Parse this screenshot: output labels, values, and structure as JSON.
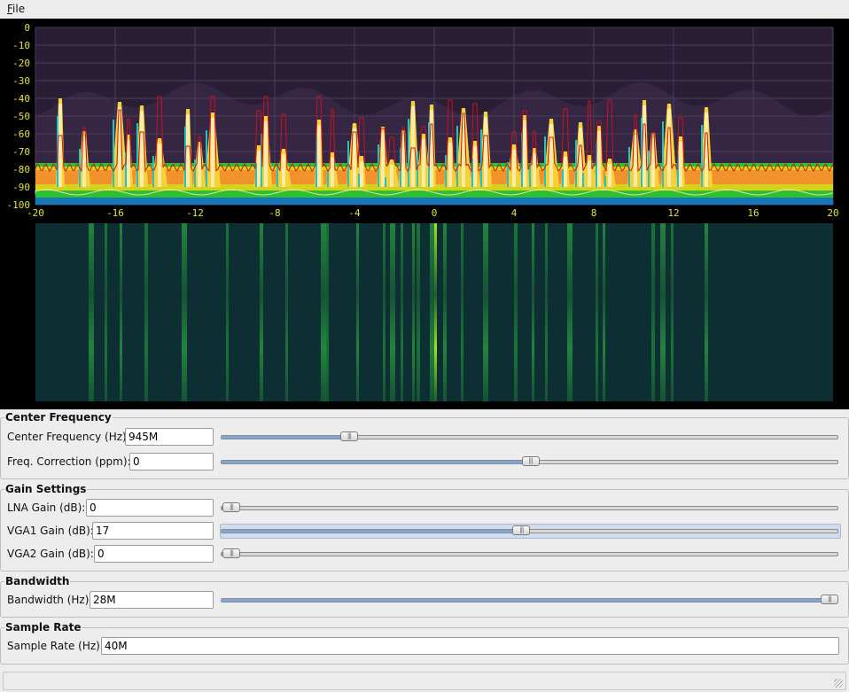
{
  "menubar": {
    "file": "File"
  },
  "spectrum": {
    "y_ticks": [
      "0",
      "-10",
      "-20",
      "-30",
      "-40",
      "-50",
      "-60",
      "-70",
      "-80",
      "-90",
      "-100"
    ],
    "x_ticks": [
      "-20",
      "-16",
      "-12",
      "-8",
      "-4",
      "0",
      "4",
      "8",
      "12",
      "16",
      "20"
    ],
    "colors": {
      "background": "#000000",
      "plot_bg": "#2a1d36",
      "axis_text": "#e6e23c",
      "peak_hold": "#d01020"
    }
  },
  "center_frequency": {
    "title": "Center Frequency",
    "freq_label": "Center Frequency (Hz):",
    "freq_value": "945M",
    "freq_slider_level": 0.197,
    "corr_label": "Freq. Correction (ppm):",
    "corr_value": "0",
    "corr_slider_level": 0.5
  },
  "gain": {
    "title": "Gain Settings",
    "lna_label": "LNA Gain (dB):",
    "lna_value": "0",
    "lna_slider_level": 0.0,
    "vga1_label": "VGA1 Gain (dB):",
    "vga1_value": "17",
    "vga1_slider_level": 0.485,
    "vga2_label": "VGA2 Gain (dB):",
    "vga2_value": "0",
    "vga2_slider_level": 0.0
  },
  "bandwidth": {
    "title": "Bandwidth",
    "label": "Bandwidth (Hz):",
    "value": "28M",
    "slider_level": 1.0
  },
  "sample_rate": {
    "title": "Sample Rate",
    "label": "Sample Rate (Hz):",
    "value": "40M"
  }
}
